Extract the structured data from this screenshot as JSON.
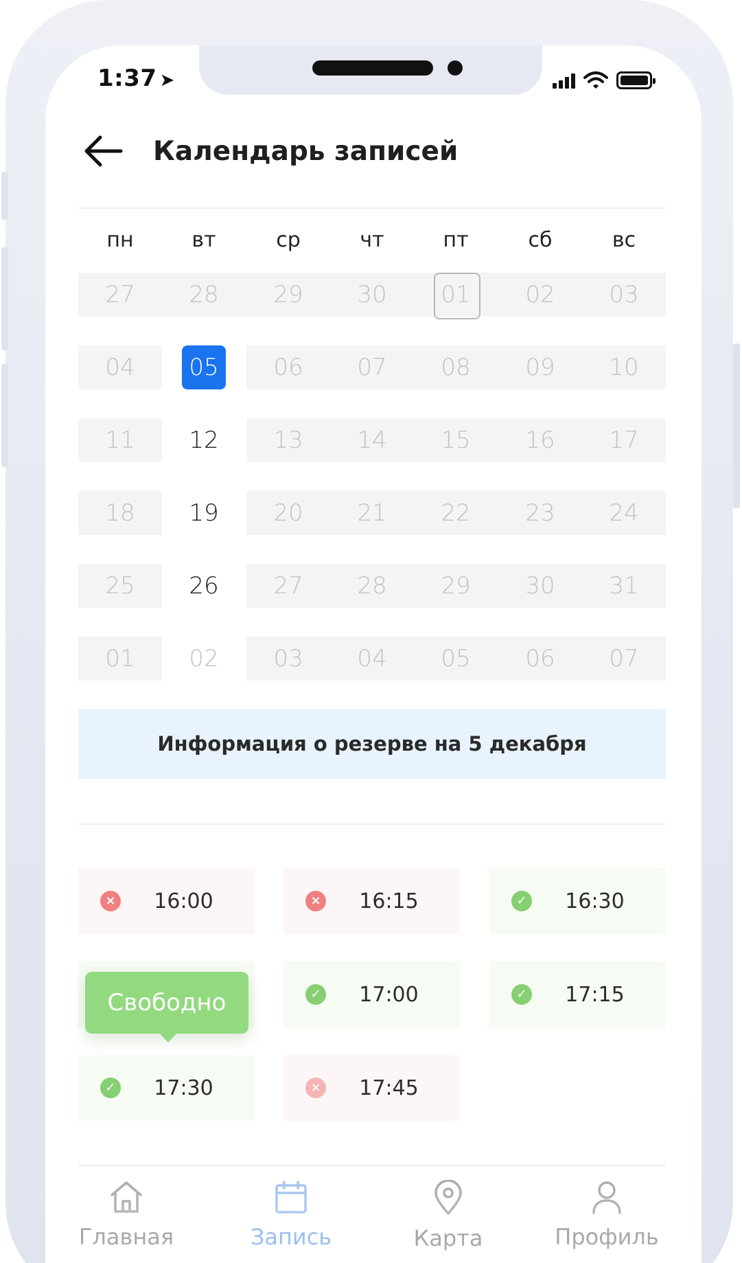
{
  "status_bar": {
    "time": "1:37",
    "location_icon": "location-arrow-icon",
    "signal_icon": "cellular-signal-icon",
    "wifi_icon": "wifi-icon",
    "battery_icon": "battery-icon"
  },
  "header": {
    "title": "Календарь записей",
    "back_icon": "arrow-left-icon"
  },
  "calendar": {
    "weekdays": [
      "пн",
      "вт",
      "ср",
      "чт",
      "пт",
      "сб",
      "вс"
    ],
    "rows": [
      [
        "27",
        "28",
        "29",
        "30",
        "01",
        "02",
        "03"
      ],
      [
        "04",
        "05",
        "06",
        "07",
        "08",
        "09",
        "10"
      ],
      [
        "11",
        "12",
        "13",
        "14",
        "15",
        "16",
        "17"
      ],
      [
        "18",
        "19",
        "20",
        "21",
        "22",
        "23",
        "24"
      ],
      [
        "25",
        "26",
        "27",
        "28",
        "29",
        "30",
        "31"
      ],
      [
        "01",
        "02",
        "03",
        "04",
        "05",
        "06",
        "07"
      ]
    ],
    "selected_day": "05",
    "today_marker_day": "01",
    "colors": {
      "selected": "#1a73ef",
      "inactive_bg": "#f4f4f4"
    }
  },
  "info": {
    "title": "Информация о резерве на 5 декабря"
  },
  "slots": [
    {
      "time": "16:00",
      "status": "busy"
    },
    {
      "time": "16:15",
      "status": "busy"
    },
    {
      "time": "16:30",
      "status": "free"
    },
    {
      "time": "17:00",
      "status": "free"
    },
    {
      "time": "17:15",
      "status": "free"
    },
    {
      "time": "17:30",
      "status": "free"
    },
    {
      "time": "17:45",
      "status": "busy"
    }
  ],
  "tooltip": {
    "text": "Свободно"
  },
  "tabbar": {
    "items": [
      {
        "label": "Главная",
        "icon": "home-icon"
      },
      {
        "label": "Запись",
        "icon": "calendar-icon"
      },
      {
        "label": "Карта",
        "icon": "map-pin-icon"
      },
      {
        "label": "Профиль",
        "icon": "user-icon"
      }
    ],
    "active_index": 1,
    "colors": {
      "active": "#7aa8ea",
      "inactive": "#8b8b8b"
    }
  }
}
